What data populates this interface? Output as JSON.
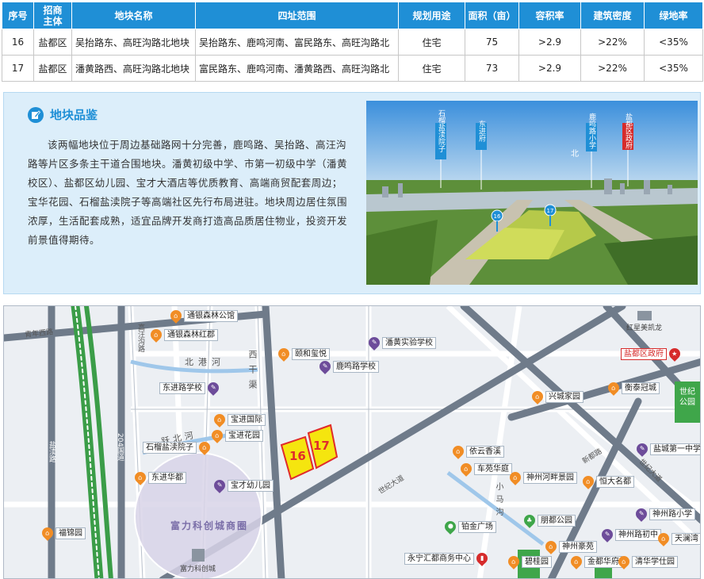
{
  "table": {
    "headers": [
      "序号",
      "招商\n主体",
      "地块名称",
      "四址范围",
      "规划用途",
      "面积（亩）",
      "容积率",
      "建筑密度",
      "绿地率"
    ],
    "rows": [
      [
        "16",
        "盐都区",
        "吴抬路东、高旺沟路北地块",
        "吴抬路东、鹿鸣河南、富民路东、高旺沟路北",
        "住宅",
        "75",
        ">2.9",
        ">22%",
        "<35%"
      ],
      [
        "17",
        "盐都区",
        "潘黄路西、高旺沟路北地块",
        "富民路东、鹿鸣河南、潘黄路西、高旺沟路北",
        "住宅",
        "73",
        ">2.9",
        ">22%",
        "<35%"
      ]
    ]
  },
  "intro": {
    "title": "地块品鉴",
    "text": "该两幅地块位于周边基础路网十分完善，鹿鸣路、吴抬路、高汪沟路等片区多条主干道合围地块。潘黄初级中学、市第一初级中学（潘黄校区）、盐都区幼儿园、宝才大酒店等优质教育、高端商贸配套周边；宝华花园、石榴盐渎院子等高端社区先行布局进驻。地块周边居住氛围浓厚，生活配套成熟，适宜品牌开发商打造高品质居住物业，投资开发前景值得期待。",
    "photo_labels": [
      "石榴盐渎院子",
      "东进府",
      "鹿鸣路小学",
      "盐都区政府"
    ],
    "photo_markers": [
      "16",
      "17"
    ],
    "photo_north": "北"
  },
  "map": {
    "area_label": "富力科创城商圈",
    "parcels": [
      "16",
      "17"
    ],
    "landmarks": [
      "红星美凯龙",
      "富力科创城"
    ],
    "park_label": "世纪公园",
    "roads": [
      "青年西路",
      "盐渎路",
      "盐渎路",
      "204国道",
      "高汪沟路",
      "北港河",
      "北港河",
      "跃北河",
      "西干渠",
      "西干渠",
      "世纪大道",
      "小马沟",
      "新都路",
      "新都路",
      "潘黄路",
      "世纪大道"
    ],
    "pois": [
      {
        "label": "通银森林公馆",
        "type": "orange"
      },
      {
        "label": "通银森林红郡",
        "type": "orange"
      },
      {
        "label": "潘黄实验学校",
        "type": "purple"
      },
      {
        "label": "颐和玺悦",
        "type": "orange"
      },
      {
        "label": "鹿鸣路学校",
        "type": "purple"
      },
      {
        "label": "盐都区政府",
        "type": "red"
      },
      {
        "label": "东进路学校",
        "type": "purple"
      },
      {
        "label": "兴城家园",
        "type": "orange"
      },
      {
        "label": "衡泰冠城",
        "type": "orange"
      },
      {
        "label": "宝进国际",
        "type": "orange"
      },
      {
        "label": "宝进花园",
        "type": "orange"
      },
      {
        "label": "石榴盐渎院子",
        "type": "orange"
      },
      {
        "label": "东进华都",
        "type": "orange"
      },
      {
        "label": "宝才幼儿园",
        "type": "purple"
      },
      {
        "label": "依云香溪",
        "type": "orange"
      },
      {
        "label": "车苑华庭",
        "type": "orange"
      },
      {
        "label": "神州河畔景园",
        "type": "orange"
      },
      {
        "label": "恒大名都",
        "type": "orange"
      },
      {
        "label": "盐城第一中学",
        "type": "purple"
      },
      {
        "label": "神州路小学",
        "type": "purple"
      },
      {
        "label": "福锦园",
        "type": "orange"
      },
      {
        "label": "铂金广场",
        "type": "green"
      },
      {
        "label": "朋都公园",
        "type": "green"
      },
      {
        "label": "神州路初中",
        "type": "purple"
      },
      {
        "label": "天澜湾",
        "type": "orange"
      },
      {
        "label": "神州豪苑",
        "type": "orange"
      },
      {
        "label": "永宁汇都商务中心",
        "type": "red"
      },
      {
        "label": "碧桂园",
        "type": "orange"
      },
      {
        "label": "金都华府",
        "type": "orange"
      },
      {
        "label": "清华学仕园",
        "type": "orange"
      }
    ]
  },
  "colors": {
    "header_blue": "#1f8fd6",
    "panel_bg": "#dceefa",
    "parcel_yellow": "#f5e50f",
    "parcel_text": "#e02b2b",
    "poi_orange": "#f18d25",
    "poi_purple": "#6d4c9a",
    "poi_green": "#3fa64a",
    "poi_red": "#d62b2b"
  }
}
